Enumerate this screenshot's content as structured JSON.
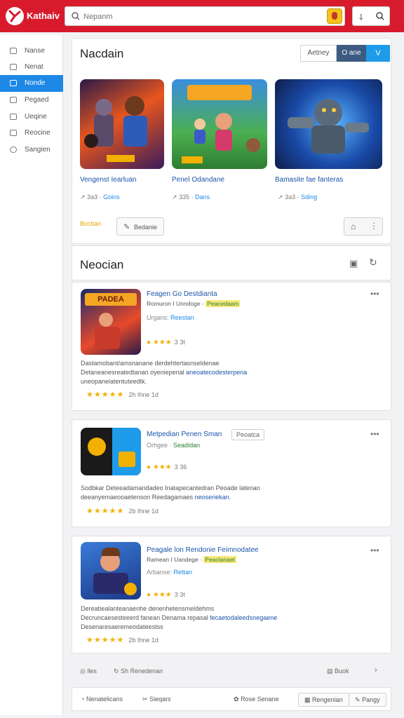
{
  "app": {
    "brand": "Kathaiv"
  },
  "search": {
    "placeholder": "Nepanm"
  },
  "sidebar": {
    "items": [
      {
        "label": "Nanse"
      },
      {
        "label": "Nenat"
      },
      {
        "label": "Nonde"
      },
      {
        "label": "Pegaed"
      },
      {
        "label": "Ueqine"
      },
      {
        "label": "Reocine"
      },
      {
        "label": "Sangien"
      }
    ]
  },
  "featured": {
    "title": "Nacdain",
    "segments": [
      "Aetney",
      "O ane",
      "V"
    ],
    "games": [
      {
        "name": "Vengenst Iearluan",
        "meta": "3ə3 ·",
        "tag": "Goins"
      },
      {
        "name": "Penel Odandane",
        "meta": "335 ·",
        "tag": "Dans"
      },
      {
        "name": "Bamasite fae fanteras",
        "meta": "3ə3 ·",
        "tag": "Sding"
      }
    ],
    "tag_button": "Boctian",
    "action_button": "Bedanie"
  },
  "newsection": {
    "title": "Neocian",
    "items": [
      {
        "title": "Feagen Go Destdianta",
        "sub": "Romuron I Unndoge",
        "sub_hl": "Peacedaam",
        "cat_label": "Urgans:",
        "cat": "Reestan",
        "rating": "3 3t",
        "desc1": "Dastamobant/amsnanane derdehtertasnseldenae",
        "desc2": "Detaneanesreatedtanan oyeniepenal",
        "desc2_link": "aneoatecodesterpena",
        "desc3": "uneopanelatentuteedtk.",
        "review": "2h Ihne 1d",
        "icon_text": "PADEA"
      },
      {
        "title": "Metpedian Penen Sman",
        "badge": "Peoatca",
        "cat_label": "Orhgee ·",
        "cat": "Seadidan",
        "rating": "3 36",
        "desc1": "Sodbkar Deteeadamandadeo Inatapecantedran Peoade latenan",
        "desc2": "deeanyemaeooaetenson Reedagamaes",
        "desc2_link": "neoseriekan.",
        "review": "2b Ihne 1d"
      },
      {
        "title": "Peagale lon Rendonie Feimnodatee",
        "sub": "Ramean I Uandege",
        "sub_hl": "Peaclanaet",
        "cat_label": "Arbanse:",
        "cat": "Rettan",
        "rating": "3 3t",
        "desc1": "Dereabealanteanaenhe denenhetensmeldehms",
        "desc2": "Decruncaesesteeerd fanean Denama repasal",
        "desc2_link": "fecaetodaleedsnegaene",
        "desc3": "Desenaresaeremeodateestss",
        "review": "2b Ihne 1d"
      }
    ]
  },
  "footer": {
    "left1": "lles",
    "left2": "Sh Renedenan",
    "right1": "Buok",
    "b1": "Nenatelicans",
    "b2": "Sieqars",
    "b3": "Rose Senane",
    "b4": "Rengenian",
    "b5": "Pangy"
  },
  "colors": {
    "brand": "#d81b2c",
    "accent": "#1e88e5",
    "star": "#f2b100"
  }
}
